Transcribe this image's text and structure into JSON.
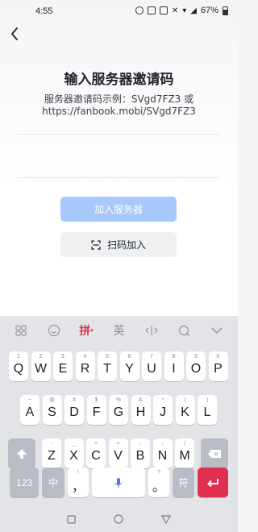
{
  "status_bar": {
    "time": "4:55",
    "battery": "67%"
  },
  "page": {
    "title": "输入服务器邀请码",
    "hint_line1": "服务器邀请码示例：SVgd7FZ3 或",
    "hint_line2": "https://fanbook.mobi/SVgd7FZ3",
    "join_button": "加入服务器",
    "scan_button": "扫码加入"
  },
  "keyboard": {
    "toolbar": {
      "pinyin": "拼",
      "english": "英"
    },
    "row1": [
      {
        "sub": "1",
        "key": "Q"
      },
      {
        "sub": "2",
        "key": "W"
      },
      {
        "sub": "3",
        "key": "E"
      },
      {
        "sub": "4",
        "key": "R"
      },
      {
        "sub": "5",
        "key": "T"
      },
      {
        "sub": "6",
        "key": "Y"
      },
      {
        "sub": "7",
        "key": "U"
      },
      {
        "sub": "8",
        "key": "I"
      },
      {
        "sub": "9",
        "key": "O"
      },
      {
        "sub": "0",
        "key": "P"
      }
    ],
    "row2": [
      {
        "sub": "~",
        "key": "A"
      },
      {
        "sub": "@",
        "key": "S"
      },
      {
        "sub": "#",
        "key": "D"
      },
      {
        "sub": "$",
        "key": "F"
      },
      {
        "sub": "%",
        "key": "G"
      },
      {
        "sub": "&",
        "key": "H"
      },
      {
        "sub": "*",
        "key": "J"
      },
      {
        "sub": "(",
        "key": "K"
      },
      {
        "sub": ")",
        "key": "L"
      }
    ],
    "row3": [
      {
        "sub": "-",
        "key": "Z"
      },
      {
        "sub": "_",
        "key": "X"
      },
      {
        "sub": "+",
        "key": "C"
      },
      {
        "sub": "=",
        "key": "V"
      },
      {
        "sub": ";",
        "key": "B"
      },
      {
        "sub": ":",
        "key": "N"
      },
      {
        "sub": "/",
        "key": "M"
      }
    ],
    "numbers_key": "123",
    "chinese_key": "中",
    "comma_sub": "!",
    "comma_key": "，",
    "period_sub": "?",
    "period_key": "。",
    "symbol_key": "符"
  }
}
